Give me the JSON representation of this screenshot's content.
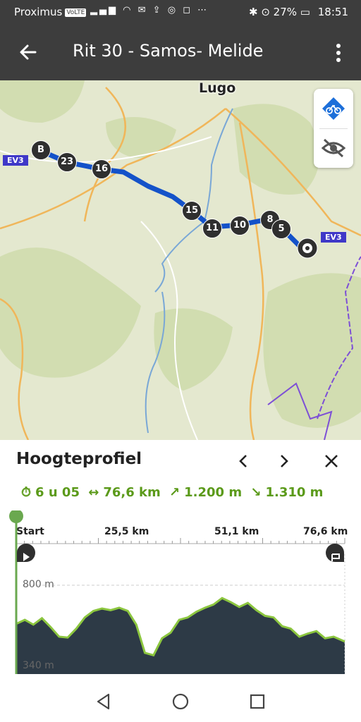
{
  "status": {
    "carrier": "Proximus",
    "volte": "VoLTE",
    "battery": "27%",
    "time": "18:51"
  },
  "appbar": {
    "title": "Rit 30 - Samos- Melide",
    "back_icon": "arrow-left-icon",
    "menu_icon": "more-vertical-icon"
  },
  "map": {
    "city_label": "Lugo",
    "road_badge": "EV3",
    "start_marker": "B",
    "waypoints": [
      "23",
      "16",
      "15",
      "11",
      "10",
      "8",
      "5"
    ],
    "controls": [
      "bike-route-icon",
      "eye-off-icon"
    ]
  },
  "profile": {
    "title": "Hoogteprofiel",
    "duration": "6 u 05",
    "distance": "76,6 km",
    "ascent": "1.200 m",
    "descent": "1.310 m",
    "x_ticks": [
      "Start",
      "25,5 km",
      "51,1 km",
      "76,6 km"
    ],
    "y_max_label": "800 m",
    "y_min_label": "340 m",
    "colors": {
      "accent": "#5b9a1a",
      "fill": "#2d3a46",
      "line": "#8cc63f"
    }
  },
  "chart_data": {
    "type": "area",
    "xlabel": "",
    "ylabel": "",
    "xlim": [
      0,
      76.6
    ],
    "ylim": [
      340,
      800
    ],
    "x": [
      0,
      2,
      4,
      6,
      8,
      10,
      12,
      14,
      16,
      18,
      20,
      22,
      24,
      26,
      28,
      30,
      32,
      34,
      36,
      38,
      40,
      42,
      44,
      46,
      48,
      50,
      52,
      54,
      56,
      58,
      60,
      62,
      64,
      66,
      68,
      70,
      72,
      74,
      76.6
    ],
    "values": [
      560,
      585,
      555,
      595,
      540,
      480,
      475,
      530,
      600,
      640,
      655,
      645,
      660,
      640,
      555,
      380,
      365,
      470,
      505,
      585,
      600,
      635,
      660,
      680,
      720,
      695,
      665,
      690,
      645,
      610,
      600,
      545,
      530,
      480,
      500,
      515,
      470,
      480,
      450
    ]
  }
}
